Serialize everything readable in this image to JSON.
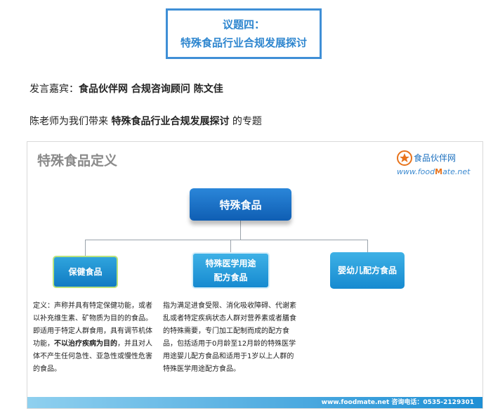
{
  "topic": {
    "line1": "议题四：",
    "line2": "特殊食品行业合规发展探讨"
  },
  "speaker": {
    "prefix": "发言嘉宾：",
    "details": "食品伙伴网 合规咨询顾问 陈文佳"
  },
  "intro": {
    "prefix": "陈老师为我们带来 ",
    "highlight": "特殊食品行业合规发展探讨",
    "suffix": " 的专题"
  },
  "slide": {
    "title": "特殊食品定义",
    "logo": {
      "name": "食品伙伴网",
      "url_pre": "www.food",
      "url_m": "M",
      "url_post": "ate.net"
    },
    "root_node": "特殊食品",
    "children": [
      {
        "label": "保健食品"
      },
      {
        "label_line1": "特殊医学用途",
        "label_line2": "配方食品"
      },
      {
        "label": "婴幼儿配方食品"
      }
    ],
    "definitions": {
      "health": {
        "lead": "定义：声称并具有特定保健功能，或者以补充维生素、矿物质为目的的食品。即适用于特定人群食用，具有调节机体功能，",
        "bold": "不以治疗疾病为目的",
        "tail": "，并且对人体不产生任何急性、亚急性或慢性危害的食品。"
      },
      "medical": "指为满足进食受限、消化吸收障碍、代谢紊乱或者特定疾病状态人群对营养素或者膳食的特殊需要，专门加工配制而成的配方食品，包括适用于0月龄至12月龄的特殊医学用途婴儿配方食品和适用于1岁以上人群的特殊医学用途配方食品。"
    },
    "footer": "www.foodmate.net   咨询电话：0535-2129301"
  },
  "colors": {
    "topic_border": "#3f8fd6",
    "topic_text": "#2e86cf",
    "root_node": "#1670c7",
    "child_node": "#1f95d6",
    "health_border": "#b9e27d",
    "footer": "#1e8fd5"
  }
}
